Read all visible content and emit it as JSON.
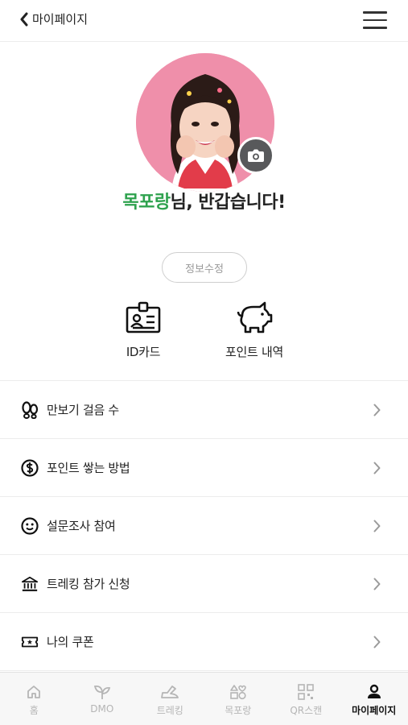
{
  "header": {
    "back_label": "마이페이지"
  },
  "profile": {
    "nickname": "목포랑",
    "greeting_suffix": "님, 반갑습니다!"
  },
  "edit_button": "정보수정",
  "quick_links": [
    {
      "label": "ID카드",
      "icon": "id-card-icon"
    },
    {
      "label": "포인트 내역",
      "icon": "piggy-bank-icon"
    }
  ],
  "menu": [
    {
      "label": "만보기 걸음 수",
      "icon": "footprints-icon"
    },
    {
      "label": "포인트 쌓는 방법",
      "icon": "dollar-coin-icon"
    },
    {
      "label": "설문조사 참여",
      "icon": "smiley-icon"
    },
    {
      "label": "트레킹 참가 신청",
      "icon": "institution-icon"
    },
    {
      "label": "나의 쿠폰",
      "icon": "ticket-icon"
    }
  ],
  "tabbar": [
    {
      "label": "홈",
      "icon": "home-icon",
      "active": false
    },
    {
      "label": "DMO",
      "icon": "sprout-icon",
      "active": false
    },
    {
      "label": "트레킹",
      "icon": "shoe-icon",
      "active": false
    },
    {
      "label": "목포랑",
      "icon": "shapes-icon",
      "active": false
    },
    {
      "label": "QR스캔",
      "icon": "qr-icon",
      "active": false
    },
    {
      "label": "마이페이지",
      "icon": "person-icon",
      "active": true
    }
  ],
  "colors": {
    "accent": "#2ea24e",
    "camera_bg": "#58595b",
    "avatar_bg": "#ef8faa"
  }
}
